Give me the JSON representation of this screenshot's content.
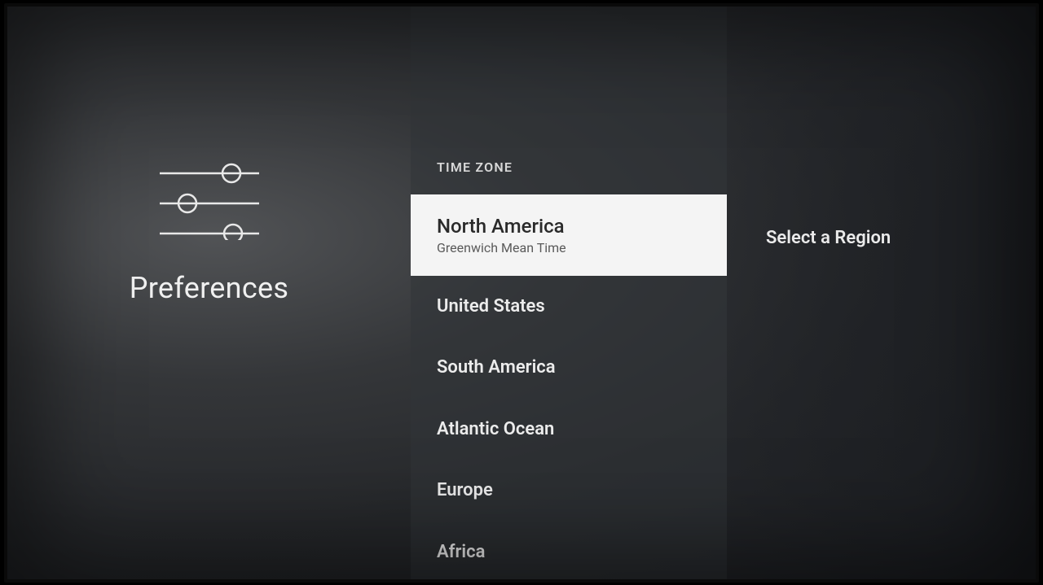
{
  "left": {
    "title": "Preferences"
  },
  "section": {
    "header": "TIME ZONE"
  },
  "items": [
    {
      "label": "North America",
      "sub": "Greenwich Mean Time",
      "selected": true
    },
    {
      "label": "United States"
    },
    {
      "label": "South America"
    },
    {
      "label": "Atlantic Ocean"
    },
    {
      "label": "Europe"
    },
    {
      "label": "Africa"
    }
  ],
  "right": {
    "title": "Select a Region"
  }
}
